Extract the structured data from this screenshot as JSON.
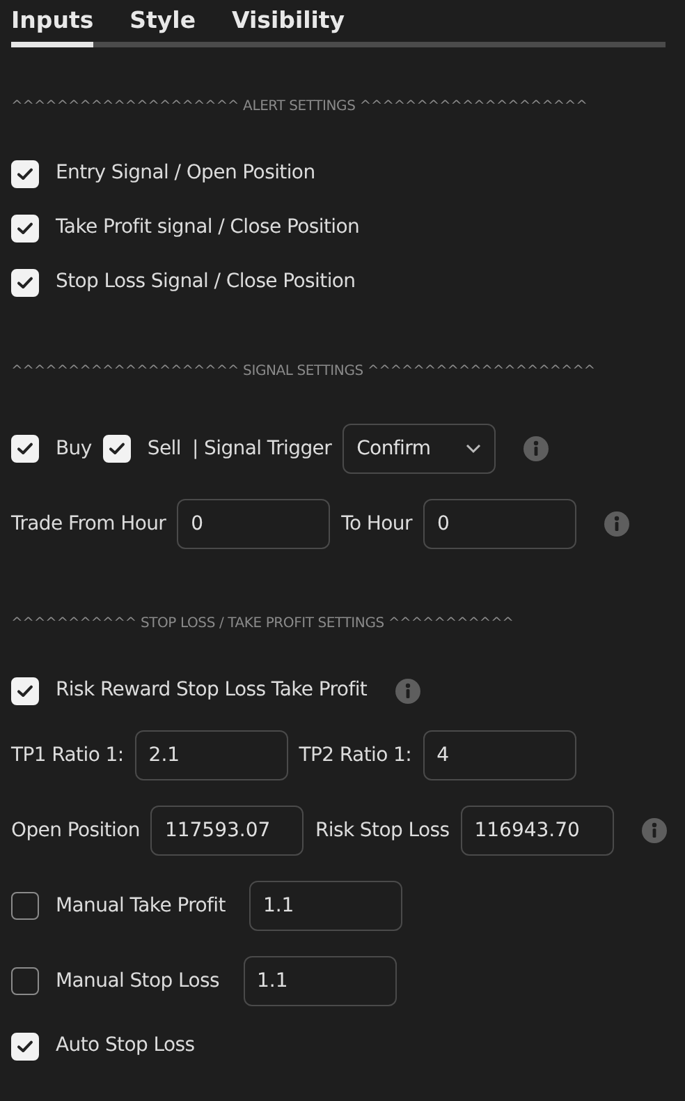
{
  "tabs": [
    {
      "label": "Inputs",
      "selected": true
    },
    {
      "label": "Style",
      "selected": false
    },
    {
      "label": "Visibility",
      "selected": false
    }
  ],
  "sections": [
    {
      "header": "^^^^^^^^^^^^^^^^^^^^ ALERT SETTINGS ^^^^^^^^^^^^^^^^^^^^",
      "rows": [
        {
          "items": [
            {
              "kind": "checkbox",
              "label": "Entry Signal / Open Position",
              "checked": true
            }
          ]
        },
        {
          "items": [
            {
              "kind": "checkbox",
              "label": "Take Profit signal / Close Position",
              "checked": true
            }
          ]
        },
        {
          "items": [
            {
              "kind": "checkbox",
              "label": "Stop Loss Signal / Close Position",
              "checked": true
            }
          ]
        }
      ]
    },
    {
      "header": "^^^^^^^^^^^^^^^^^^^^ SIGNAL SETTINGS ^^^^^^^^^^^^^^^^^^^^",
      "rows": [
        {
          "items": [
            {
              "kind": "checkbox",
              "label": "Buy",
              "checked": true
            },
            {
              "kind": "checkbox",
              "label": "Sell",
              "checked": true
            },
            {
              "kind": "text",
              "label": "| Signal Trigger"
            },
            {
              "kind": "select",
              "value": "Confirm"
            },
            {
              "kind": "info"
            }
          ]
        },
        {
          "items": [
            {
              "kind": "text",
              "label": "Trade From Hour"
            },
            {
              "kind": "input",
              "value": "0"
            },
            {
              "kind": "text",
              "label": "To Hour"
            },
            {
              "kind": "input",
              "value": "0"
            },
            {
              "kind": "info"
            }
          ]
        }
      ]
    },
    {
      "header": "^^^^^^^^^^^ STOP LOSS / TAKE PROFIT SETTINGS ^^^^^^^^^^^",
      "rows": [
        {
          "items": [
            {
              "kind": "checkbox",
              "label": "Risk Reward Stop Loss Take Profit",
              "checked": true
            },
            {
              "kind": "info"
            }
          ]
        },
        {
          "items": [
            {
              "kind": "text",
              "label": "TP1 Ratio 1:"
            },
            {
              "kind": "input",
              "value": "2.1"
            },
            {
              "kind": "text",
              "label": "TP2 Ratio 1:"
            },
            {
              "kind": "input",
              "value": "4"
            }
          ]
        },
        {
          "items": [
            {
              "kind": "text",
              "label": "Open Position"
            },
            {
              "kind": "input",
              "value": "117593.07"
            },
            {
              "kind": "text",
              "label": "Risk Stop Loss"
            },
            {
              "kind": "input",
              "value": "116943.70"
            },
            {
              "kind": "info"
            }
          ]
        },
        {
          "items": [
            {
              "kind": "checkbox",
              "label": "Manual Take Profit",
              "checked": false
            },
            {
              "kind": "input",
              "value": "1.1"
            }
          ]
        },
        {
          "items": [
            {
              "kind": "checkbox",
              "label": "Manual Stop Loss",
              "checked": false
            },
            {
              "kind": "input",
              "value": "1.1"
            }
          ]
        },
        {
          "items": [
            {
              "kind": "checkbox",
              "label": "Auto Stop Loss",
              "checked": true
            }
          ]
        }
      ]
    }
  ]
}
